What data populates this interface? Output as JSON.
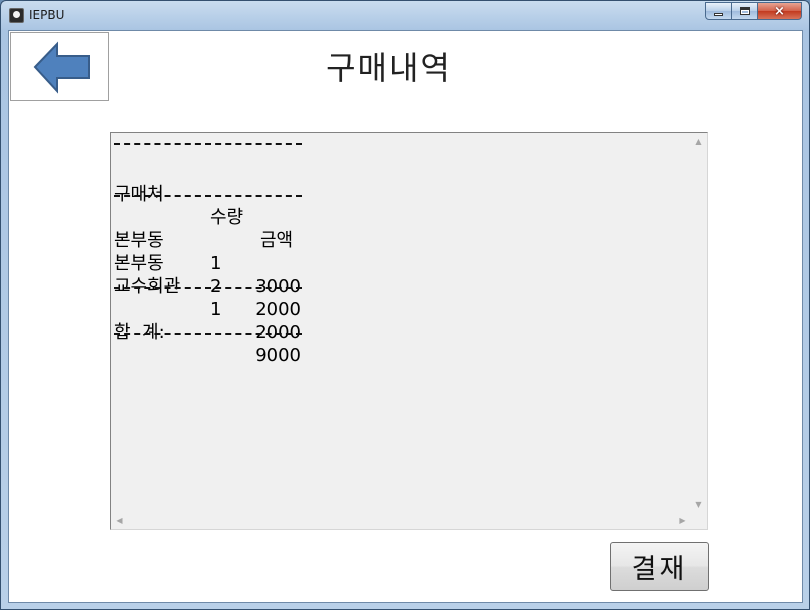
{
  "window": {
    "title": "IEPBU",
    "minimize_label": "",
    "maximize_label": "",
    "close_label": "×"
  },
  "page": {
    "title": "구매내역",
    "back_icon": "left-arrow-icon",
    "pay_label": "결재"
  },
  "receipt": {
    "headers": {
      "store": "구매처",
      "qty": "수량",
      "amount": "금액"
    },
    "rows": [
      {
        "store": "본부동",
        "qty": "1",
        "amount": "3000"
      },
      {
        "store": "본부동",
        "qty": "2",
        "amount": "2000"
      },
      {
        "store": "교수회관",
        "qty": "1",
        "amount": "2000"
      }
    ],
    "total_label": "합  계:",
    "total_value": "9000"
  },
  "colors": {
    "arrow_fill": "#4f81bd",
    "arrow_stroke": "#385d8a"
  }
}
